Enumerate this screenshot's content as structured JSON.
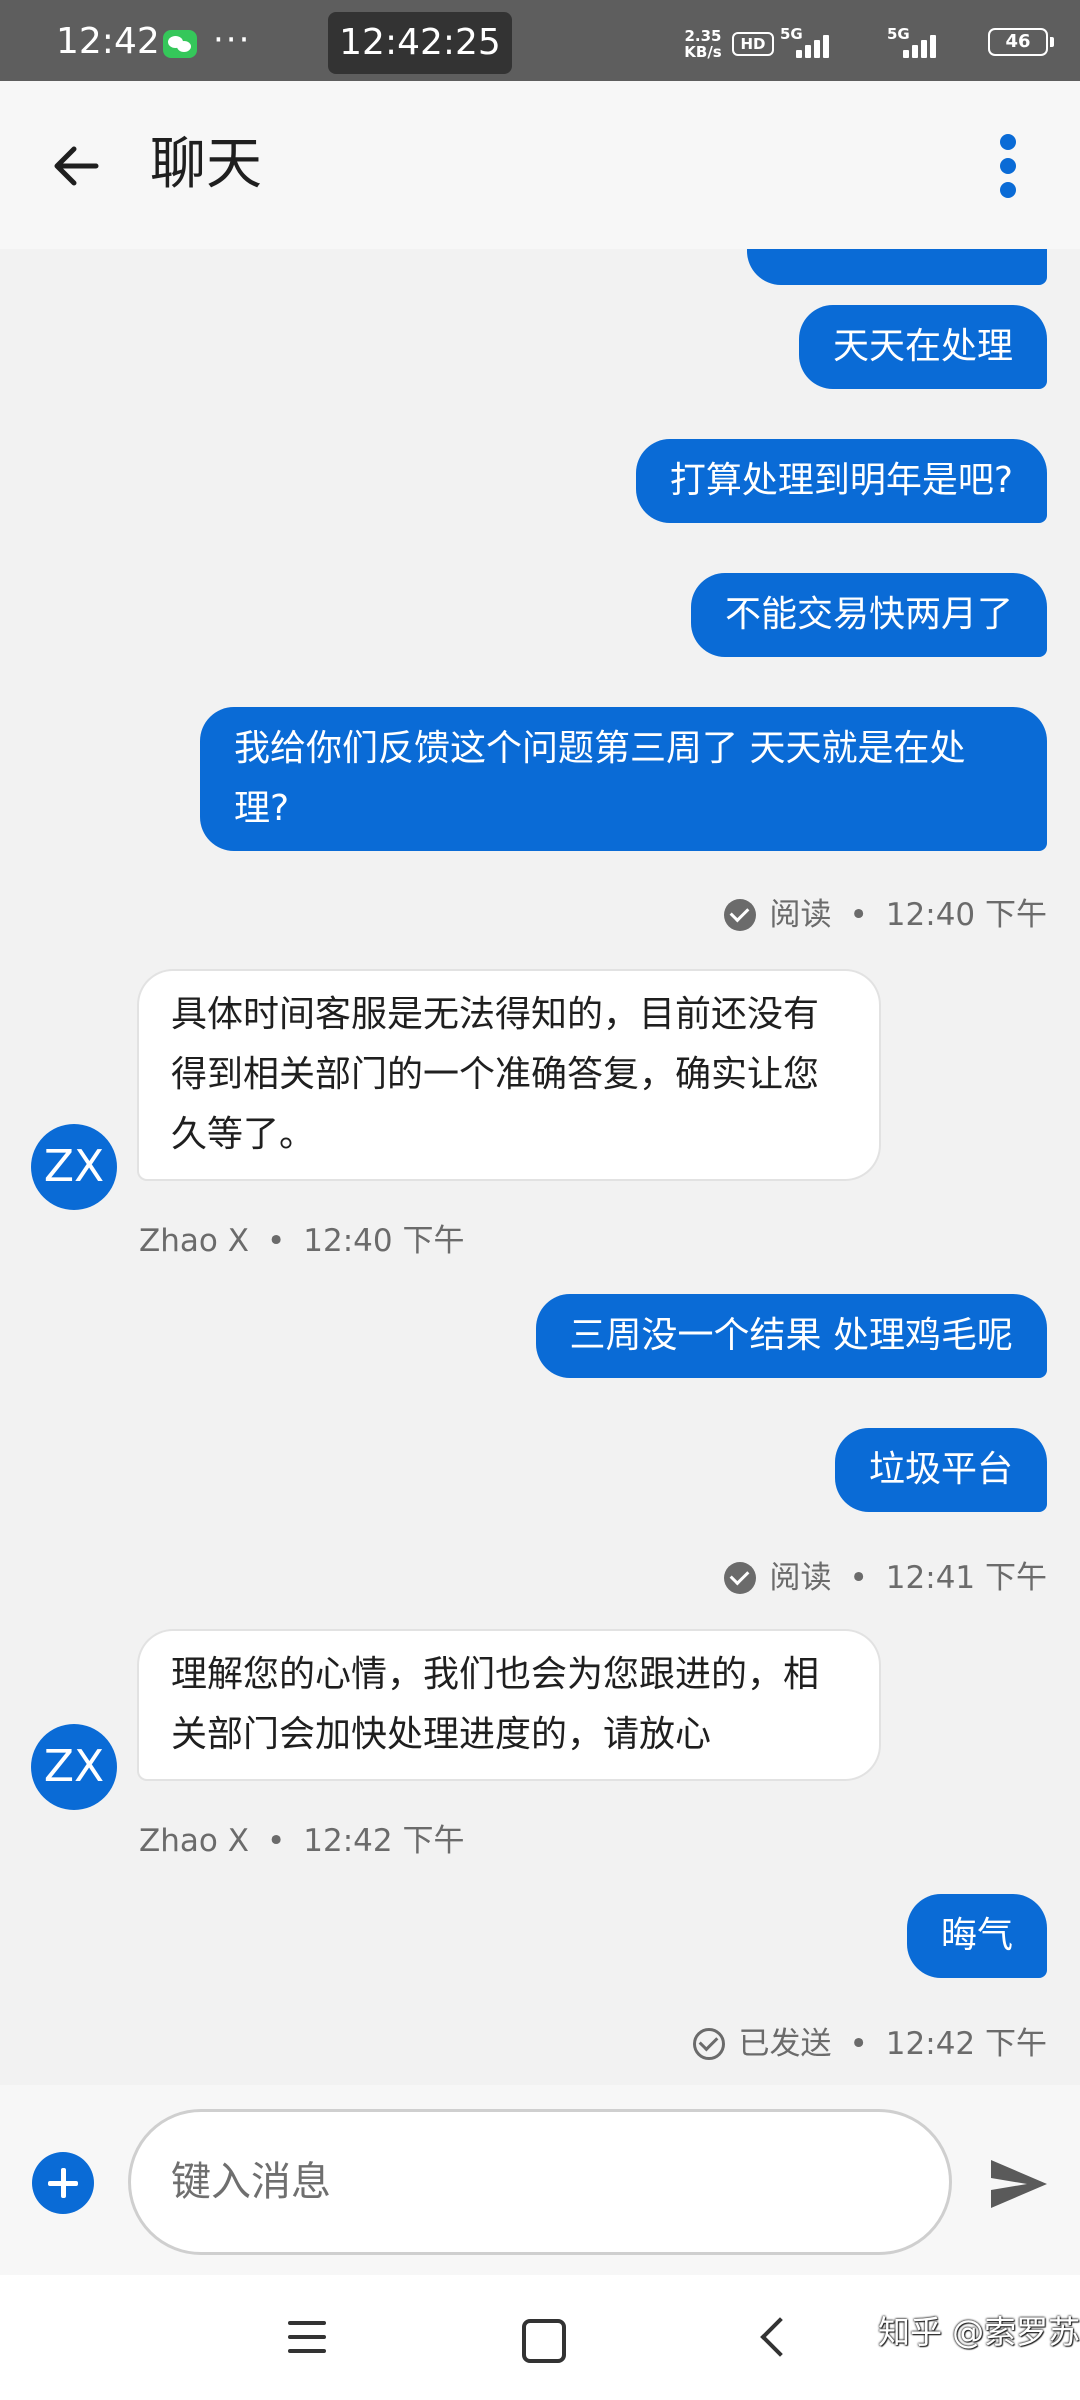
{
  "status_bar": {
    "time": "12:42",
    "more": "···",
    "clock_overlay": "12:42:25",
    "net_speed_value": "2.35",
    "net_speed_unit": "KB/s",
    "hd_label": "HD",
    "signal_1_label": "5G",
    "signal_2_label": "5G",
    "battery": "46",
    "icons": [
      "wechat-icon",
      "hd-icon",
      "signal-icon",
      "signal-icon",
      "battery-icon"
    ]
  },
  "header": {
    "title": "聊天",
    "back_icon": "arrow-left-icon",
    "menu_icon": "more-vertical-icon"
  },
  "messages": [
    {
      "id": "m1",
      "direction": "out",
      "text": "天天在处理"
    },
    {
      "id": "m2",
      "direction": "out",
      "text": "打算处理到明年是吧?"
    },
    {
      "id": "m3",
      "direction": "out",
      "text": "不能交易快两月了"
    },
    {
      "id": "m4",
      "direction": "out",
      "text": "我给你们反馈这个问题第三周了  天天就是在处理?"
    },
    {
      "id": "s1",
      "type": "status",
      "status": "阅读",
      "dot": "•",
      "time": "12:40 下午"
    },
    {
      "id": "m5",
      "direction": "in",
      "avatar": "ZX",
      "text": "具体时间客服是无法得知的，目前还没有得到相关部门的一个准确答复，确实让您久等了。"
    },
    {
      "id": "s2",
      "type": "sender",
      "sender": "Zhao X",
      "dot": "•",
      "time": "12:40 下午"
    },
    {
      "id": "m6",
      "direction": "out",
      "text": "三周没一个结果  处理鸡毛呢"
    },
    {
      "id": "m7",
      "direction": "out",
      "text": "垃圾平台"
    },
    {
      "id": "s3",
      "type": "status",
      "status": "阅读",
      "dot": "•",
      "time": "12:41 下午"
    },
    {
      "id": "m8",
      "direction": "in",
      "avatar": "ZX",
      "text": "理解您的心情，我们也会为您跟进的，相关部门会加快处理进度的，请放心"
    },
    {
      "id": "s4",
      "type": "sender",
      "sender": "Zhao X",
      "dot": "•",
      "time": "12:42 下午"
    },
    {
      "id": "m9",
      "direction": "out",
      "text": "晦气"
    },
    {
      "id": "s5",
      "type": "status",
      "status": "已发送",
      "dot": "•",
      "time": "12:42 下午"
    }
  ],
  "composer": {
    "placeholder": "键入消息",
    "add_icon": "plus-circle-icon",
    "send_icon": "send-icon"
  },
  "nav_bar": {
    "icons": [
      "menu-icon",
      "home-square-icon",
      "back-chevron-icon"
    ]
  },
  "watermark": "知乎 @索罗苏",
  "colors": {
    "accent": "#0a6bd6",
    "background": "#f2f2f2",
    "status_bar": "#5e5e5e",
    "incoming_bubble": "#ffffff",
    "outgoing_text": "#ffffff",
    "meta_text": "#6b6b6b"
  }
}
